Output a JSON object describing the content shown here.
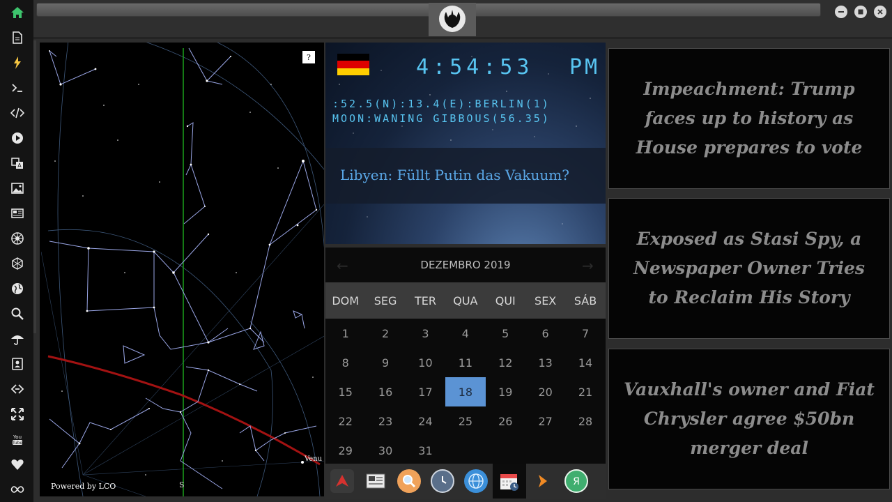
{
  "sidebar": {
    "items": [
      {
        "icon": "home-icon",
        "color": "#3ec46d"
      },
      {
        "icon": "document-icon"
      },
      {
        "icon": "lightning-icon",
        "color": "#f5c542"
      },
      {
        "icon": "terminal-icon"
      },
      {
        "icon": "code-icon"
      },
      {
        "icon": "play-icon"
      },
      {
        "icon": "translate-icon"
      },
      {
        "icon": "image-icon"
      },
      {
        "icon": "newspaper-icon"
      },
      {
        "icon": "rebel-icon"
      },
      {
        "icon": "empire-icon"
      },
      {
        "icon": "globe-icon"
      },
      {
        "icon": "search-icon"
      },
      {
        "icon": "umbrella-icon"
      },
      {
        "icon": "contacts-icon"
      },
      {
        "icon": "link-icon"
      },
      {
        "icon": "expand-icon"
      },
      {
        "icon": "youtube-icon"
      },
      {
        "icon": "heart-icon"
      },
      {
        "icon": "infinity-icon"
      }
    ]
  },
  "starchart": {
    "help_label": "?",
    "powered_by": "Powered by LCO",
    "south_label": "S",
    "venus_label": "Venu"
  },
  "clock": {
    "flag_colors": [
      "#000000",
      "#dd0000",
      "#ffce00"
    ],
    "time": "4:54:53",
    "ampm": "PM",
    "location_line": ":52.5(N):13.4(E):BERLIN(1)",
    "moon_line": "MOON:WANING GIBBOUS(56.35)",
    "headline": "Libyen: Füllt Putin das Vakuum?"
  },
  "calendar": {
    "month_label": "DEZEMBRO 2019",
    "weekdays": [
      "DOM",
      "SEG",
      "TER",
      "QUA",
      "QUI",
      "SEX",
      "SÁB"
    ],
    "weeks": [
      [
        "1",
        "2",
        "3",
        "4",
        "5",
        "6",
        "7"
      ],
      [
        "8",
        "9",
        "10",
        "11",
        "12",
        "13",
        "14"
      ],
      [
        "15",
        "16",
        "17",
        "18",
        "19",
        "20",
        "21"
      ],
      [
        "22",
        "23",
        "24",
        "25",
        "26",
        "27",
        "28"
      ],
      [
        "29",
        "30",
        "31",
        "",
        "",
        "",
        ""
      ]
    ],
    "today": "18",
    "today_color": "#5b93d4"
  },
  "dock": {
    "apps": [
      {
        "icon": "arrow-app-icon",
        "color": "#d6322f"
      },
      {
        "icon": "news-app-icon",
        "color": "#e9e9e9"
      },
      {
        "icon": "search-app-icon",
        "color": "#f0a25a"
      },
      {
        "icon": "clock-app-icon",
        "color": "#5a6f8a"
      },
      {
        "icon": "browser-app-icon",
        "color": "#3b8fd9"
      },
      {
        "icon": "calendar-app-icon",
        "color": "#e84a4a"
      },
      {
        "icon": "next-app-icon",
        "color": "#f08a24"
      },
      {
        "icon": "yandex-app-icon",
        "color": "#3fae6f"
      }
    ]
  },
  "news": [
    {
      "headline": "Impeachment: Trump faces up to history as House prepares to vote"
    },
    {
      "headline": "Exposed as Stasi Spy, a Newspaper Owner Tries to Reclaim His Story"
    },
    {
      "headline": "Vauxhall's owner and Fiat Chrysler agree $50bn merger deal"
    }
  ]
}
